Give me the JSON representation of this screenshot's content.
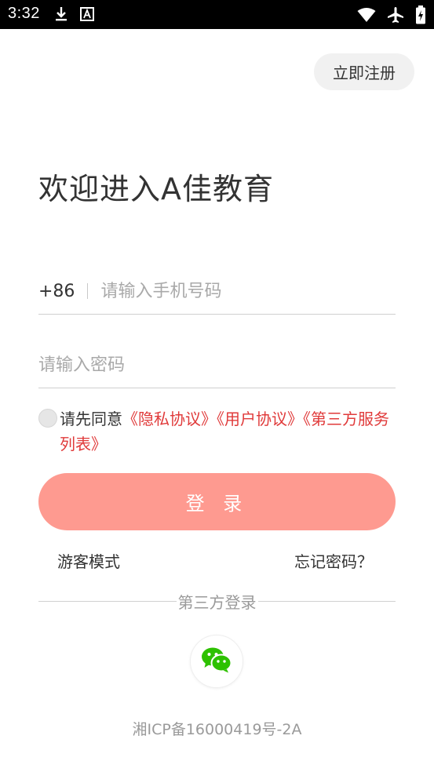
{
  "status_bar": {
    "time": "3:32",
    "icons": [
      "download-icon",
      "a-box-icon",
      "wifi-icon",
      "airplane-icon",
      "battery-icon"
    ]
  },
  "header": {
    "register_label": "立即注册"
  },
  "welcome": {
    "title": "欢迎进入A佳教育"
  },
  "phone": {
    "country_code": "+86",
    "placeholder": "请输入手机号码",
    "value": ""
  },
  "password": {
    "placeholder": "请输入密码",
    "value": ""
  },
  "agreement": {
    "prefix": "请先同意",
    "privacy_link": "《隐私协议》",
    "user_link": "《用户协议》",
    "third_party_link": "《第三方服务列表》",
    "checked": false
  },
  "login": {
    "label": "登 录"
  },
  "links": {
    "guest": "游客模式",
    "forgot": "忘记密码？"
  },
  "third_party": {
    "label": "第三方登录",
    "providers": [
      "wechat-icon"
    ]
  },
  "footer": {
    "icp": "湘ICP备16000419号-2A"
  },
  "colors": {
    "accent_button": "#fe9a90",
    "link_red": "#e03a3a",
    "wechat_green": "#2dc100"
  }
}
